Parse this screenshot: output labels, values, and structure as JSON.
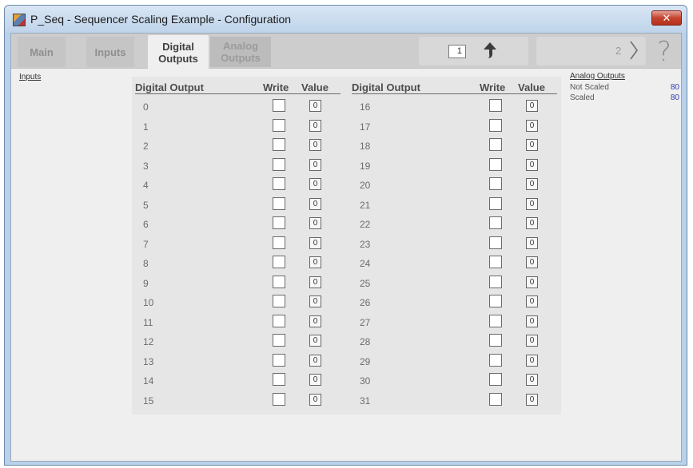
{
  "window": {
    "title": "P_Seq - Sequencer Scaling Example - Configuration",
    "close_label": "✕"
  },
  "tabs": [
    {
      "label": "Main"
    },
    {
      "label": "Inputs"
    },
    {
      "label": "Digital Outputs"
    },
    {
      "label": "Analog Outputs"
    }
  ],
  "nav": {
    "page_value": "1",
    "next_page": "2",
    "help_glyph": "?"
  },
  "left": {
    "inputs_link": "Inputs"
  },
  "table": {
    "headers": {
      "output": "Digital Output",
      "write": "Write",
      "value": "Value"
    },
    "left_rows": [
      {
        "num": "0",
        "value": "0"
      },
      {
        "num": "1",
        "value": "0"
      },
      {
        "num": "2",
        "value": "0"
      },
      {
        "num": "3",
        "value": "0"
      },
      {
        "num": "4",
        "value": "0"
      },
      {
        "num": "5",
        "value": "0"
      },
      {
        "num": "6",
        "value": "0"
      },
      {
        "num": "7",
        "value": "0"
      },
      {
        "num": "8",
        "value": "0"
      },
      {
        "num": "9",
        "value": "0"
      },
      {
        "num": "10",
        "value": "0"
      },
      {
        "num": "11",
        "value": "0"
      },
      {
        "num": "12",
        "value": "0"
      },
      {
        "num": "13",
        "value": "0"
      },
      {
        "num": "14",
        "value": "0"
      },
      {
        "num": "15",
        "value": "0"
      }
    ],
    "right_rows": [
      {
        "num": "16",
        "value": "0"
      },
      {
        "num": "17",
        "value": "0"
      },
      {
        "num": "18",
        "value": "0"
      },
      {
        "num": "19",
        "value": "0"
      },
      {
        "num": "20",
        "value": "0"
      },
      {
        "num": "21",
        "value": "0"
      },
      {
        "num": "22",
        "value": "0"
      },
      {
        "num": "23",
        "value": "0"
      },
      {
        "num": "24",
        "value": "0"
      },
      {
        "num": "25",
        "value": "0"
      },
      {
        "num": "26",
        "value": "0"
      },
      {
        "num": "27",
        "value": "0"
      },
      {
        "num": "28",
        "value": "0"
      },
      {
        "num": "29",
        "value": "0"
      },
      {
        "num": "30",
        "value": "0"
      },
      {
        "num": "31",
        "value": "0"
      }
    ]
  },
  "analog_outputs": {
    "title": "Analog Outputs",
    "rows": [
      {
        "label": "Not Scaled",
        "value": "80"
      },
      {
        "label": "Scaled",
        "value": "80"
      }
    ]
  },
  "colors": {
    "analog_value": "#2d3db4",
    "window_frame": "#b9d1ea",
    "close_button": "#c4442f"
  },
  "icons": [
    "app-icon",
    "close-icon",
    "up-arrow-icon",
    "chevron-right-icon",
    "help-icon"
  ]
}
